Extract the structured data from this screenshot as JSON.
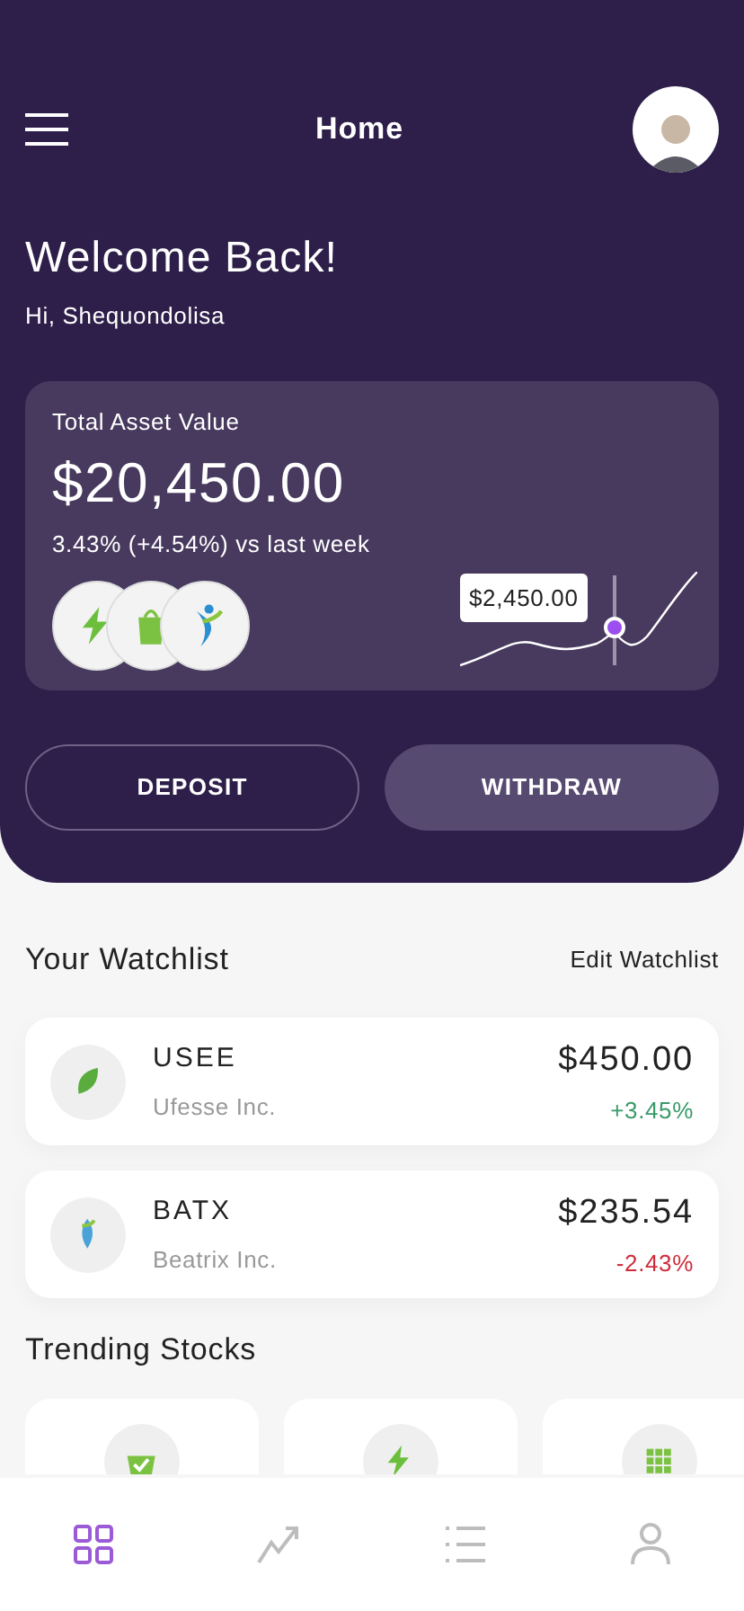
{
  "header": {
    "title": "Home"
  },
  "welcome": {
    "title": "Welcome Back!",
    "subtitle": "Hi, Shequondolisa"
  },
  "asset_card": {
    "label": "Total Asset Value",
    "value": "$20,450.00",
    "change": "3.43% (+4.54%) vs last week",
    "tooltip": "$2,450.00",
    "holdings": [
      {
        "kind": "bolt"
      },
      {
        "kind": "bag"
      },
      {
        "kind": "figure"
      }
    ]
  },
  "buttons": [
    {
      "label": "DEPOSIT",
      "kind": "outline"
    },
    {
      "label": "WITHDRAW",
      "kind": "filled"
    }
  ],
  "watchlist": {
    "title": "Your Watchlist",
    "action": "Edit Watchlist",
    "items": [
      {
        "kind": "leaf",
        "symbol": "USEE",
        "company": "Ufesse Inc.",
        "price": "$450.00",
        "change": "+3.45%",
        "color": "#3a9a6a"
      },
      {
        "kind": "drop",
        "symbol": "BATX",
        "company": "Beatrix Inc.",
        "price": "$235.54",
        "change": "-2.43%",
        "color": "#d02c3a"
      }
    ]
  },
  "trending": {
    "title": "Trending Stocks",
    "items": [
      {
        "kind": "basket"
      },
      {
        "kind": "bolt"
      },
      {
        "kind": "grid"
      }
    ]
  },
  "nav": [
    {
      "kind": "grid",
      "selected": true
    },
    {
      "kind": "chart",
      "selected": false
    },
    {
      "kind": "list",
      "selected": false
    },
    {
      "kind": "user",
      "selected": false
    }
  ]
}
